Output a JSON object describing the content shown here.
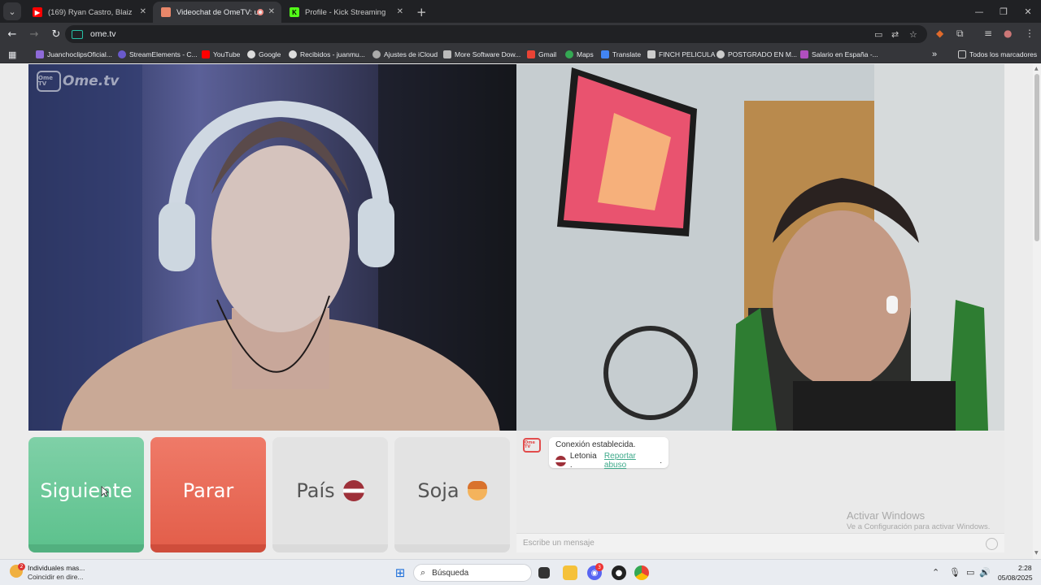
{
  "browser": {
    "tabs": [
      {
        "title": "(169) Ryan Castro, Blaiz Fayah",
        "favicon": "youtube-icon",
        "color": "#ff0000",
        "active": false
      },
      {
        "title": "Videochat de OmeTV: una",
        "favicon": "ometv-icon",
        "color": "#e8876a",
        "active": true
      },
      {
        "title": "Profile - Kick Streaming",
        "favicon": "kick-icon",
        "color": "#53fc18",
        "active": false
      }
    ],
    "url": "ome.tv",
    "bookmarks": [
      {
        "label": "JuanchoclipsOficial...",
        "color": "#8e6ad8"
      },
      {
        "label": "StreamElements - C...",
        "color": "#6a5acd"
      },
      {
        "label": "YouTube",
        "color": "#ff0000"
      },
      {
        "label": "Google",
        "color": "#dddddd"
      },
      {
        "label": "Recibidos - juanmu...",
        "color": "#dddddd"
      },
      {
        "label": "Ajustes de iCloud",
        "color": "#aaaaaa"
      },
      {
        "label": "More Software Dow...",
        "color": "#bbbbbb"
      },
      {
        "label": "Gmail",
        "color": "#ea4335"
      },
      {
        "label": "Maps",
        "color": "#34a853"
      },
      {
        "label": "Translate",
        "color": "#4285f4"
      },
      {
        "label": "FINCH PELICULA",
        "color": "#cccccc"
      },
      {
        "label": "POSTGRADO EN M...",
        "color": "#cccccc"
      },
      {
        "label": "Salario en España -...",
        "color": "#b04fbf"
      }
    ],
    "all_bookmarks": "Todos los marcadores"
  },
  "ometv": {
    "logo_small": "Ome\nTV",
    "logo_text": "Ome.tv",
    "buttons": {
      "next": "Siguiente",
      "stop": "Parar",
      "country": "País",
      "gender": "Soja"
    },
    "chat": {
      "status": "Conexión establecida.",
      "country": "Letonia .",
      "report": "Reportar abuso",
      "report_suffix": ".",
      "input_placeholder": "Escribe un mensaje"
    }
  },
  "watermark": {
    "line1": "Activar Windows",
    "line2": "Ve a Configuración para activar Windows."
  },
  "taskbar": {
    "notification_line1": "Individuales mas...",
    "notification_line2": "Coincidir en dire...",
    "search": "Búsqueda",
    "time": "2:28",
    "date": "05/08/2025",
    "discord_badge": "3"
  }
}
